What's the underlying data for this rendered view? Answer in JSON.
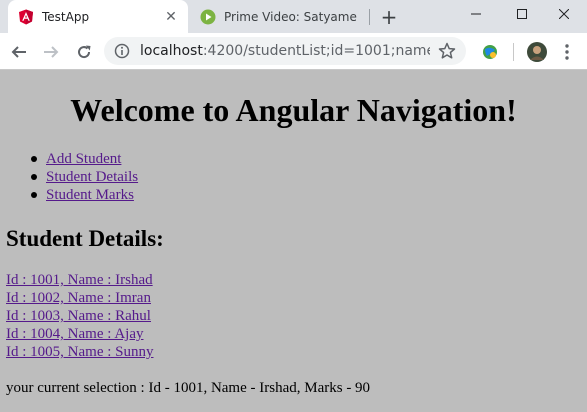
{
  "browser": {
    "tabs": [
      {
        "title": "TestApp",
        "active": true,
        "icon": "angular-logo-icon"
      },
      {
        "title": "Prime Video: Satyame",
        "active": false,
        "icon": "prime-video-icon"
      }
    ],
    "address": {
      "host": "localhost",
      "rest": ":4200/studentList;id=1001;name=Ir..."
    }
  },
  "page": {
    "heading": "Welcome to Angular Navigation!",
    "nav_links": [
      {
        "label": "Add Student"
      },
      {
        "label": "Student Details"
      },
      {
        "label": "Student Marks"
      }
    ],
    "section_title": "Student Details:",
    "students": [
      {
        "label": "Id : 1001, Name : Irshad"
      },
      {
        "label": "Id : 1002, Name : Imran"
      },
      {
        "label": "Id : 1003, Name : Rahul"
      },
      {
        "label": "Id : 1004, Name : Ajay"
      },
      {
        "label": "Id : 1005, Name : Sunny"
      }
    ],
    "selection_text": "your current selection : Id - 1001, Name - Irshad, Marks - 90"
  },
  "colors": {
    "page_background": "#bdbdbd",
    "link": "#551a8b",
    "angular_red": "#dd0031",
    "prime_green": "#7cb342"
  }
}
